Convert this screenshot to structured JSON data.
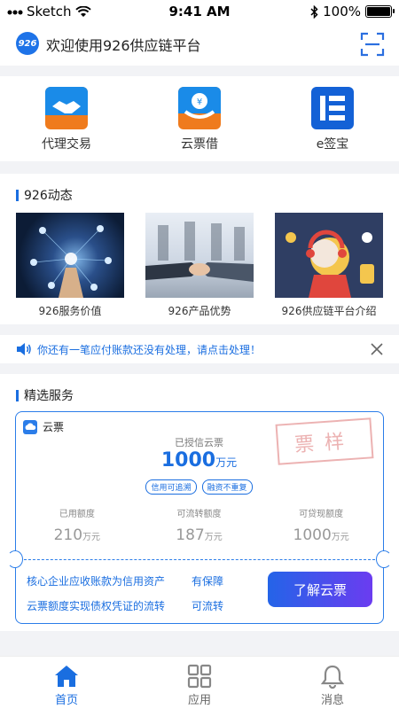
{
  "status_bar": {
    "carrier": "Sketch",
    "time": "9:41 AM",
    "battery": "100%"
  },
  "header": {
    "logo_text": "926",
    "title": "欢迎使用926供应链平台"
  },
  "quick_apps": [
    {
      "label": "代理交易",
      "icon": "handshake-icon"
    },
    {
      "label": "云票借",
      "icon": "hand-coin-icon"
    },
    {
      "label": "e签宝",
      "icon": "e-sign-icon"
    }
  ],
  "news": {
    "section_title": "926动态",
    "items": [
      {
        "label": "926服务价值"
      },
      {
        "label": "926产品优势"
      },
      {
        "label": "926供应链平台介绍"
      }
    ]
  },
  "notice": {
    "text": "你还有一笔应付账款还没有处理，请点击处理！"
  },
  "featured": {
    "section_title": "精选服务",
    "card": {
      "tag": "云票",
      "stamp": "票样",
      "credit_label": "已授信云票",
      "credit_value": "1000",
      "credit_unit": "万元",
      "chips": [
        "信用可追溯",
        "融资不重复"
      ],
      "stats": [
        {
          "label": "已用额度",
          "value": "210",
          "unit": "万元"
        },
        {
          "label": "可流转额度",
          "value": "187",
          "unit": "万元"
        },
        {
          "label": "可贷现额度",
          "value": "1000",
          "unit": "万元"
        }
      ],
      "features": [
        {
          "text": "核心企业应收账款为信用资产",
          "value": "有保障"
        },
        {
          "text": "云票额度实现债权凭证的流转",
          "value": "可流转"
        }
      ],
      "button": "了解云票"
    }
  },
  "tabbar": [
    {
      "label": "首页",
      "icon": "home-icon",
      "active": true
    },
    {
      "label": "应用",
      "icon": "grid-icon",
      "active": false
    },
    {
      "label": "消息",
      "icon": "bell-icon",
      "active": false
    }
  ],
  "colors": {
    "primary": "#1a6ee0",
    "accent_purple": "#6b3cf0",
    "orange": "#ef7b1d"
  }
}
